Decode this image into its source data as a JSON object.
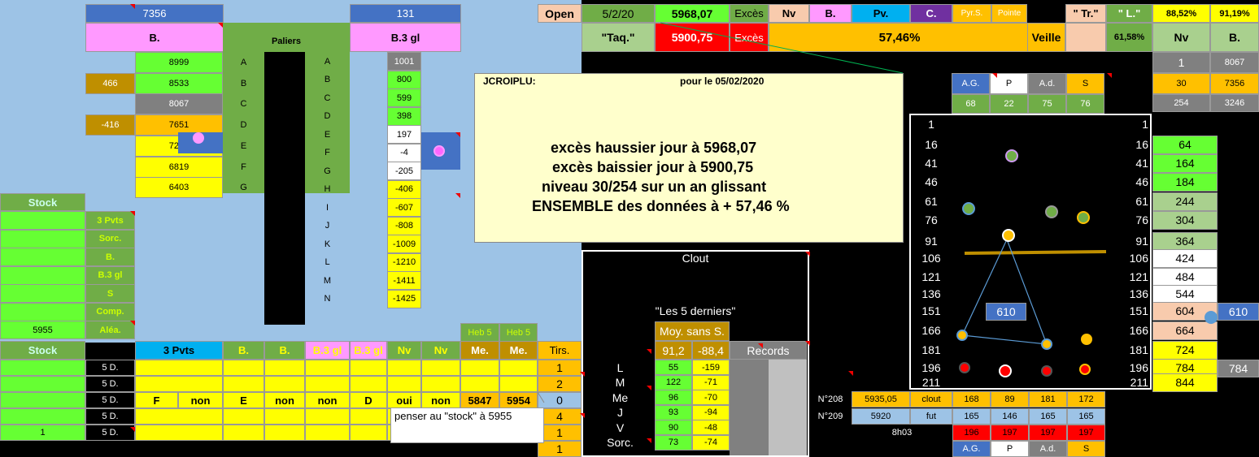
{
  "colors": {
    "green": "#66ff33",
    "yellow": "#ffff00",
    "orange": "#ffc000",
    "lightblue": "#9dc3e6",
    "blue": "#4472c4",
    "pink": "#ff99ff",
    "olive": "#70ad47",
    "lightyellow": "#ffffcc",
    "red": "#ff0000",
    "purple": "#7030a0",
    "cyan": "#00b0f0",
    "peach": "#f8cbad",
    "lightgreen": "#a9d08e",
    "grey": "#808080"
  },
  "left": {
    "num7356": "7356",
    "num131": "131",
    "b_label": "B.",
    "paliers": "Paliers",
    "b3gl": "B.3 gl",
    "b_vals": [
      "8999",
      "8533",
      "8067",
      "7651",
      "7235",
      "6819",
      "6403"
    ],
    "offsets": [
      "466",
      "-416"
    ],
    "letters": [
      "A",
      "B",
      "C",
      "D",
      "E",
      "F",
      "G"
    ],
    "letters2": [
      "A",
      "B",
      "C",
      "D",
      "E",
      "F",
      "G",
      "H",
      "I",
      "J",
      "K",
      "L",
      "M",
      "N"
    ],
    "b3_vals": [
      "1001",
      "800",
      "599",
      "398",
      "197",
      "-4",
      "-205",
      "-406",
      "-607",
      "-808",
      "-1009",
      "-1210",
      "-1411",
      "-1425"
    ]
  },
  "stock": {
    "title": "Stock",
    "title2": "Stock",
    "labels": [
      "3 Pvts",
      "Sorc.",
      "B.",
      "B.3 gl",
      "S",
      "Comp.",
      "Aléa."
    ],
    "value": "5955",
    "one": "1"
  },
  "heb": [
    "Heb 5",
    "Heb 5"
  ],
  "headers": [
    "3 Pvts",
    "B.",
    "B.",
    "B.3 gl",
    "B.3 gl",
    "Nv",
    "Nv",
    "Me.",
    "Me."
  ],
  "fived": "5 D.",
  "row3": [
    "F",
    "non",
    "E",
    "non",
    "non",
    "D",
    "oui",
    "non",
    "5847",
    "5954"
  ],
  "tirs": {
    "title": "Tirs.",
    "vals": [
      "1",
      "2",
      "0",
      "4",
      "1",
      "1"
    ]
  },
  "note": "penser au \"stock\" à 5955",
  "top": {
    "open": "Open",
    "date": "5/2/20",
    "open_val": "5968,07",
    "exces": "Excès",
    "nv": "Nv",
    "b": "B.",
    "pv": "Pv.",
    "c": "C.",
    "pyrs": "Pyr.S.",
    "pointe": "Pointe",
    "tr": "\" Tr.\"",
    "l": "\" L.\"",
    "pct1": "88,52%",
    "pct2": "91,19%",
    "taq": "\"Taq.\"",
    "taq_val": "5900,75",
    "exces2": "Excès",
    "pct_main": "57,46%",
    "veille": "Veille",
    "pct3": "61,58%",
    "nv2": "Nv",
    "b2": "B.",
    "nv_val": "1",
    "b_val": "8067"
  },
  "textbox": {
    "ticker": "JCROIPLU:",
    "pour": "pour le  05/02/2020",
    "lines": [
      "excès haussier jour à 5968,07",
      "excès baissier jour à 5900,75",
      "niveau  30/254 sur un an glissant",
      "ENSEMBLE des données à + 57,46  %"
    ]
  },
  "agp": {
    "labels": [
      "A.G.",
      "P",
      "A.d.",
      "S"
    ],
    "vals": [
      "68",
      "22",
      "75",
      "76"
    ]
  },
  "rightcol": {
    "a": "30",
    "b": "7356",
    "c": "254",
    "d": "3246"
  },
  "scale": [
    "1",
    "16",
    "41",
    "46",
    "61",
    "76",
    "91",
    "106",
    "121",
    "136",
    "151",
    "166",
    "181",
    "196",
    "211"
  ],
  "rscale": [
    "1",
    "16",
    "41",
    "46",
    "61",
    "76",
    "91",
    "106",
    "121",
    "136",
    "151",
    "166",
    "181",
    "196",
    "211"
  ],
  "rvals": [
    "",
    "64",
    "164",
    "184",
    "244",
    "304",
    "364",
    "424",
    "484",
    "544",
    "604",
    "664",
    "724",
    "784",
    "844"
  ],
  "box610": "610",
  "side610": "610",
  "side784": "784",
  "clout": {
    "title": "Clout",
    "sub": "\"Les 5 derniers\"",
    "moy": "Moy. sans S.",
    "records": "Records",
    "avg": [
      "91,2",
      "-88,4"
    ],
    "labels": [
      "L",
      "M",
      "Me",
      "J",
      "V",
      "Sorc."
    ],
    "pos": [
      "55",
      "122",
      "96",
      "93",
      "90",
      "73"
    ],
    "neg": [
      "-159",
      "-71",
      "-70",
      "-94",
      "-48",
      "-74"
    ]
  },
  "bottomright": {
    "n208": "N°208",
    "n209": "N°209",
    "time": "8h03",
    "r1": [
      "5935,05",
      "clout",
      "168",
      "89",
      "181",
      "172"
    ],
    "r2": [
      "5920",
      "fut",
      "165",
      "146",
      "165",
      "165"
    ],
    "r3": [
      "196",
      "197",
      "197",
      "197"
    ],
    "footer": [
      "A.G.",
      "P",
      "A.d.",
      "S"
    ]
  }
}
